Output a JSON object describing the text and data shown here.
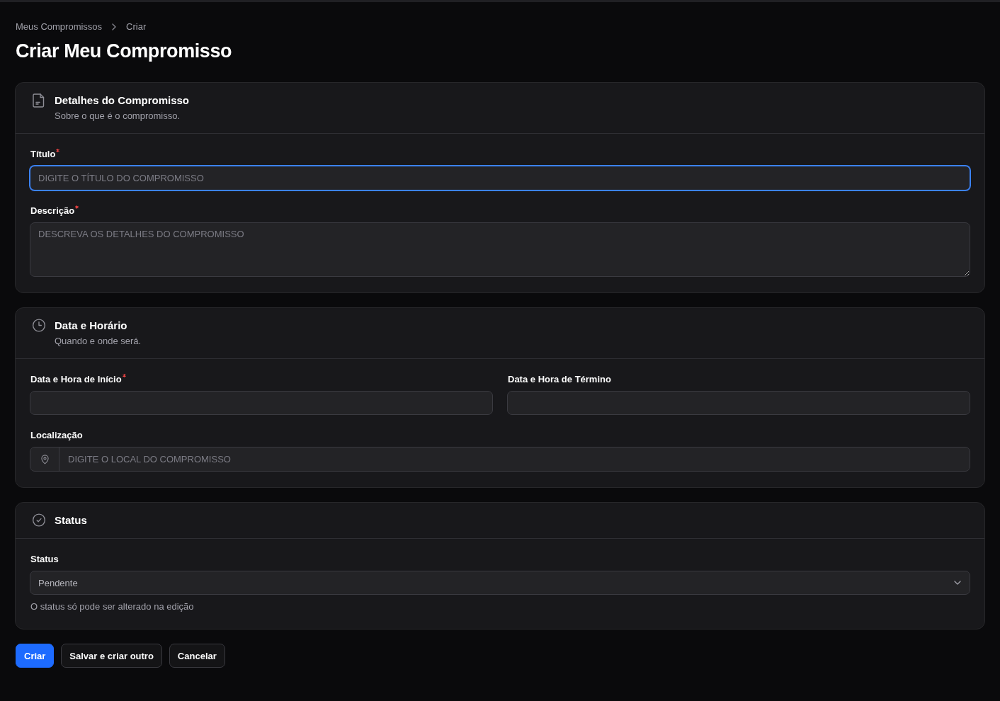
{
  "breadcrumbs": [
    {
      "label": "Meus Compromissos"
    },
    {
      "label": "Criar"
    }
  ],
  "title": "Criar Meu Compromisso",
  "sections": [
    {
      "title": "Detalhes do Compromisso",
      "description": "Sobre o que é o compromisso.",
      "rows": [
        {
          "fields": [
            {
              "kind": "text",
              "label": "Título",
              "required": true,
              "placeholder": "DIGITE O TÍTULO DO COMPROMISSO",
              "focused": true
            }
          ]
        },
        {
          "fields": [
            {
              "kind": "textarea",
              "label": "Descrição",
              "required": true,
              "placeholder": "DESCREVA OS DETALHES DO COMPROMISSO",
              "focused": false
            }
          ]
        }
      ]
    },
    {
      "title": "Data e Horário",
      "description": "Quando e onde será.",
      "rows": [
        {
          "fields": [
            {
              "kind": "text",
              "label": "Data e Hora de Início",
              "required": true,
              "focused": false
            },
            {
              "kind": "text",
              "label": "Data e Hora de Término",
              "required": false,
              "focused": false
            }
          ]
        },
        {
          "fields": [
            {
              "kind": "location",
              "label": "Localização",
              "required": false,
              "placeholder": "DIGITE O LOCAL DO COMPROMISSO",
              "focused": false
            }
          ]
        }
      ]
    },
    {
      "title": "Status",
      "rows": [
        {
          "fields": [
            {
              "kind": "select",
              "label": "Status",
              "required": false,
              "value": "Pendente",
              "hint": "O status só pode ser alterado na edição",
              "focused": false
            }
          ]
        }
      ]
    }
  ],
  "buttons": [
    {
      "label": "Criar",
      "kind": "primary"
    },
    {
      "label": "Salvar e criar outro",
      "kind": "secondary"
    },
    {
      "label": "Cancelar",
      "kind": "secondary"
    }
  ]
}
